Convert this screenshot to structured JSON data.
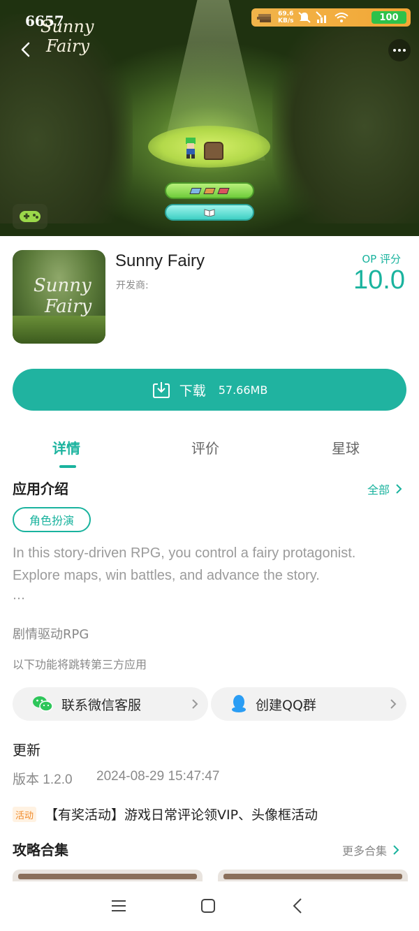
{
  "status_bar": {
    "net_speed_value": "69.6",
    "net_speed_unit": "KB/s",
    "battery": "100"
  },
  "hero": {
    "logo_overlay": "6657",
    "logo_line1": "Sunny",
    "logo_line2": "Fairy"
  },
  "app": {
    "name": "Sunny Fairy",
    "developer_label": "开发商:",
    "score_label": "OP 评分",
    "score_value": "10.0",
    "icon_line1": "Sunny",
    "icon_line2": "Fairy"
  },
  "download": {
    "label": "下载",
    "size": "57.66MB"
  },
  "tabs": [
    {
      "label": "详情",
      "active": true
    },
    {
      "label": "评价",
      "active": false
    },
    {
      "label": "星球",
      "active": false
    }
  ],
  "intro": {
    "title": "应用介绍",
    "more_label": "全部",
    "tag": "角色扮演",
    "description": "In this story-driven RPG, you control a fairy protagonist. Explore maps, win battles, and advance the story.",
    "ellipsis": "…",
    "subtitle": "剧情驱动RPG",
    "third_party_note": "以下功能将跳转第三方应用"
  },
  "links": [
    {
      "label": "联系微信客服",
      "icon": "wechat-icon"
    },
    {
      "label": "创建QQ群",
      "icon": "qq-icon"
    }
  ],
  "update": {
    "title": "更新",
    "version": "版本 1.2.0",
    "date": "2024-08-29 15:47:47",
    "event_badge": "活动",
    "event_text": "【有奖活动】游戏日常评论领VIP、头像框活动"
  },
  "guides": {
    "title": "攻略合集",
    "more_label": "更多合集"
  },
  "colors": {
    "accent": "#1ab39e",
    "download_button": "#20b3a0",
    "event_badge": "#f08a2a"
  }
}
